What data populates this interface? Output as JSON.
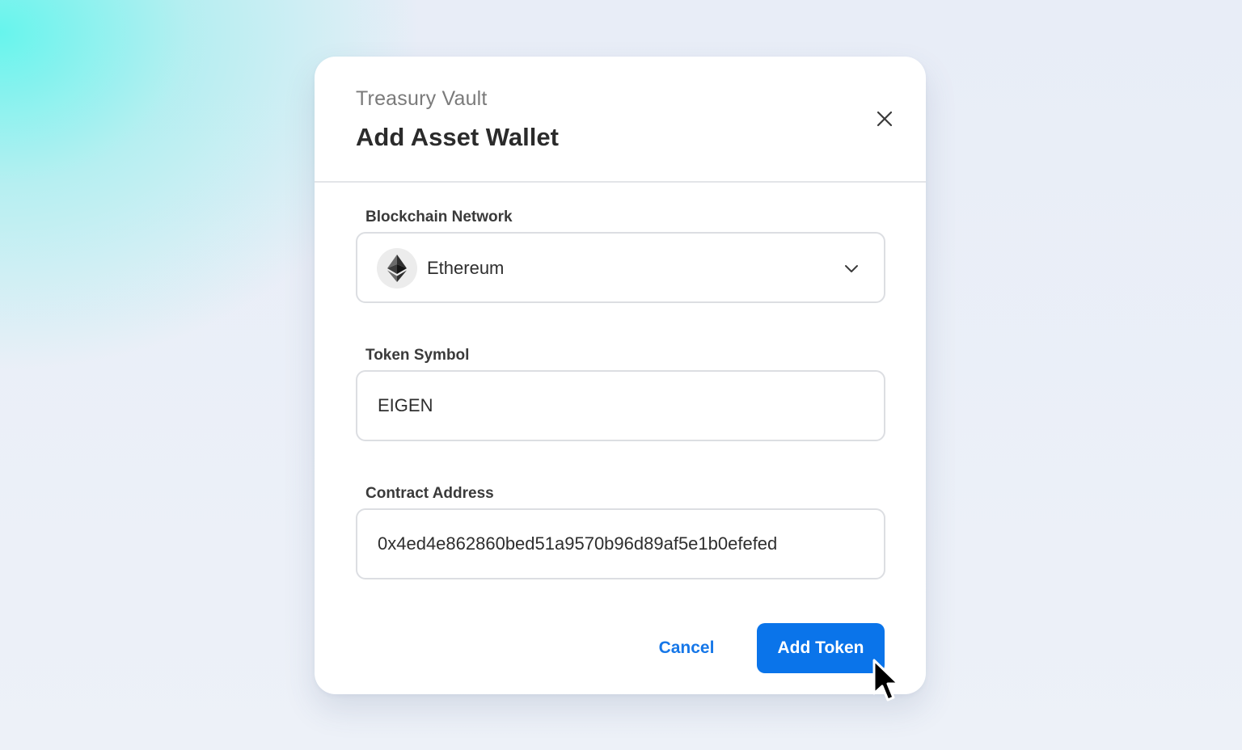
{
  "dialog": {
    "eyebrow": "Treasury Vault",
    "title": "Add Asset Wallet",
    "close_icon": "close-icon"
  },
  "fields": {
    "network": {
      "label": "Blockchain Network",
      "value": "Ethereum",
      "icon": "ethereum-icon",
      "dropdown_icon": "chevron-down-icon"
    },
    "symbol": {
      "label": "Token Symbol",
      "value": "EIGEN"
    },
    "address": {
      "label": "Contract Address",
      "value": "0x4ed4e862860bed51a9570b96d89af5e1b0efefed"
    }
  },
  "actions": {
    "cancel_label": "Cancel",
    "submit_label": "Add Token"
  },
  "colors": {
    "accent": "#0a74ea",
    "link": "#1677e8",
    "background_glow": "#60f5ec"
  },
  "cursor_icon": "mouse-pointer-icon"
}
